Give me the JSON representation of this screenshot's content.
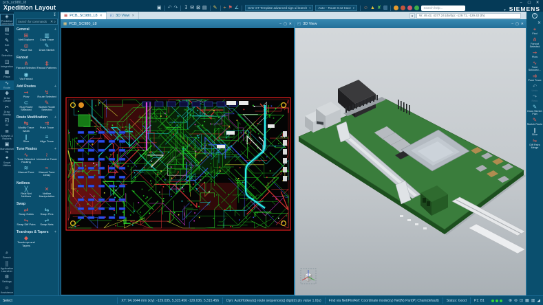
{
  "window": {
    "caption": "pcb_sc980_l8",
    "app_title": "Xpedition Layout",
    "brand": "SIEMENS",
    "controls": [
      {
        "name": "minimize-button",
        "glyph": "–"
      },
      {
        "name": "maximize-button",
        "glyph": "▢"
      },
      {
        "name": "close-button",
        "glyph": "✕"
      }
    ]
  },
  "toolbar": {
    "search_placeholder": "Search help...",
    "coordinate_readout": "W: 49.42, 4377.24 (dx/dy):  -129.71, -129.42 (th)",
    "items": [
      {
        "type": "icon",
        "name": "save-icon",
        "glyph": "▣",
        "color": "#cfe3ed"
      },
      {
        "type": "sep"
      },
      {
        "type": "icon",
        "name": "undo-icon",
        "glyph": "↶",
        "color": "#8fb6ca"
      },
      {
        "type": "icon",
        "name": "redo-icon",
        "glyph": "↷",
        "color": "#8fb6ca"
      },
      {
        "type": "sep"
      },
      {
        "type": "icon",
        "name": "pin-icon",
        "glyph": "↧",
        "color": "#cfe3ed"
      },
      {
        "type": "icon",
        "name": "mail-icon",
        "glyph": "✉",
        "color": "#cfe3ed"
      },
      {
        "type": "icon",
        "name": "lock-icon",
        "glyph": "⊠",
        "color": "#cfe3ed"
      },
      {
        "type": "icon",
        "name": "print-icon",
        "glyph": "▤",
        "color": "#cfe3ed"
      },
      {
        "type": "sep"
      },
      {
        "type": "icon",
        "name": "pencil-icon",
        "glyph": "✎",
        "color": "#e8c75a"
      },
      {
        "type": "sep"
      },
      {
        "type": "icon",
        "name": "probe-icon",
        "glyph": "⌖",
        "color": "#e0a060"
      },
      {
        "type": "icon",
        "name": "flag-icon",
        "glyph": "⚑",
        "color": "#d06060"
      },
      {
        "type": "icon",
        "name": "measure-icon",
        "glyph": "∠",
        "color": "#7fd1e8"
      },
      {
        "type": "sep"
      },
      {
        "type": "dropdown",
        "name": "scheme-dropdown",
        "label": "Over ST-Template advanced sign ui branch"
      },
      {
        "type": "dropdown",
        "name": "license-dropdown",
        "label": "Auto – Route 0:42 trace"
      },
      {
        "type": "sep"
      },
      {
        "type": "icon",
        "name": "person-icon",
        "glyph": "☺",
        "color": "#c08060"
      },
      {
        "type": "icon",
        "name": "warning-icon",
        "glyph": "▲",
        "color": "#e8c33a"
      },
      {
        "type": "icon",
        "name": "drc-icon",
        "glyph": "✘",
        "color": "#58b858"
      },
      {
        "type": "icon",
        "name": "clipboard-icon",
        "glyph": "▥",
        "color": "#7fb3d9"
      },
      {
        "type": "sep"
      },
      {
        "type": "circle",
        "name": "autosave-status-icon",
        "color": "#e59b2e"
      },
      {
        "type": "circle",
        "name": "sync-status-icon",
        "color": "#c2563e"
      },
      {
        "type": "circle",
        "name": "review-status-icon",
        "color": "#d4556a"
      },
      {
        "type": "circle",
        "name": "online-status-icon",
        "color": "#3fae49"
      },
      {
        "type": "search"
      }
    ]
  },
  "tabs": [
    {
      "label": "PCB_SC980_L8",
      "glyph": "▦",
      "glyph_color": "#c0504e",
      "active": true
    },
    {
      "label": "3D View",
      "glyph": "◰",
      "glyph_color": "#4e7ec0",
      "active": false
    }
  ],
  "left_strip": {
    "items": [
      {
        "label": "Predictive Commands",
        "name": "strip-predictive-commands",
        "glyph": "◈",
        "boxed": true
      },
      {
        "label": "File",
        "name": "strip-file",
        "glyph": "▤"
      },
      {
        "label": "Edit",
        "name": "strip-edit",
        "glyph": "✎"
      },
      {
        "label": "Selection",
        "name": "strip-selection",
        "glyph": "↖"
      },
      {
        "label": "Integration",
        "name": "strip-integration",
        "glyph": "◫"
      },
      {
        "label": "Place",
        "name": "strip-place",
        "glyph": "▦"
      },
      {
        "label": "Route",
        "name": "strip-route",
        "glyph": "∿",
        "selected": true
      },
      {
        "label": "Draw Create",
        "name": "strip-draw-create",
        "glyph": "✚"
      },
      {
        "label": "Draw Modify",
        "name": "strip-draw-modify",
        "glyph": "✂"
      },
      {
        "label": "3D",
        "name": "strip-3d",
        "glyph": "◰"
      },
      {
        "label": "Analysis & Reports",
        "name": "strip-analysis-reports",
        "glyph": "≣"
      },
      {
        "label": "Manufacturing",
        "name": "strip-manufacturing",
        "glyph": "▣"
      },
      {
        "label": "Smart Utilities",
        "name": "strip-smart-utilities",
        "glyph": "✦"
      }
    ],
    "bottom_items": [
      {
        "label": "Search",
        "name": "strip-search",
        "glyph": "⌕"
      },
      {
        "label": "Application Launcher",
        "name": "strip-app-launcher",
        "glyph": "⣿"
      },
      {
        "label": "Settings",
        "name": "strip-settings",
        "glyph": "⚙"
      },
      {
        "label": "Assistance",
        "name": "strip-assistance",
        "glyph": "☺"
      }
    ]
  },
  "command_panel": {
    "search_placeholder": "Search for commands",
    "sections": [
      {
        "title": "General",
        "plus": true,
        "items": [
          {
            "label": "Net Explorer",
            "glyph": "⊞",
            "color": "#e0635c"
          },
          {
            "label": "Copy Trace",
            "glyph": "▥",
            "color": "#7fd1e8"
          },
          {
            "label": "Place Via",
            "glyph": "◎",
            "color": "#e0635c"
          },
          {
            "label": "Draw Sketch",
            "glyph": "✎",
            "color": "#7fd1e8"
          }
        ]
      },
      {
        "title": "Fanout",
        "plus": false,
        "items": [
          {
            "label": "Fanout Selected",
            "glyph": "⋔",
            "color": "#e0635c"
          },
          {
            "label": "Fanout Patterns",
            "glyph": "⋕",
            "color": "#e0635c"
          },
          {
            "label": "Via Fanout",
            "glyph": "◉",
            "color": "#7fd1e8"
          }
        ]
      },
      {
        "title": "Add Routes",
        "plus": true,
        "items": [
          {
            "label": "Plow",
            "glyph": "⇝",
            "color": "#e0635c"
          },
          {
            "label": "Route Selected",
            "glyph": "↯",
            "color": "#e0635c"
          },
          {
            "label": "Hug Route Selected",
            "glyph": "⊂",
            "color": "#7fd1e8"
          },
          {
            "label": "Sketch Route Selected",
            "glyph": "✎",
            "color": "#e0635c"
          }
        ]
      },
      {
        "title": "Route Modification",
        "plus": true,
        "items": [
          {
            "label": "Modify Trace Width",
            "glyph": "↹",
            "color": "#e0635c"
          },
          {
            "label": "Push Trace",
            "glyph": "⇉",
            "color": "#e0635c"
          },
          {
            "label": "Slice",
            "glyph": "∥",
            "color": "#7fd1e8"
          },
          {
            "label": "Align Trace",
            "glyph": "≡",
            "color": "#7fd1e8"
          }
        ]
      },
      {
        "title": "Tune Routes",
        "plus": true,
        "items": [
          {
            "label": "Tune Selected Routing",
            "glyph": "∿",
            "color": "#e0635c"
          },
          {
            "label": "Interactive Tuner",
            "glyph": "≀",
            "color": "#e0635c"
          },
          {
            "label": "Manual Tune",
            "glyph": "≋",
            "color": "#7fd1e8"
          },
          {
            "label": "Manual Tune Delay",
            "glyph": "≈",
            "color": "#e0635c"
          }
        ]
      },
      {
        "title": "Netlines",
        "plus": false,
        "items": [
          {
            "label": "Real Net Netlines",
            "glyph": "╳",
            "color": "#7fd1e8"
          },
          {
            "label": "Netline Manipulation",
            "glyph": "✕",
            "color": "#e0635c"
          }
        ]
      },
      {
        "title": "Swap",
        "plus": false,
        "items": [
          {
            "label": "Swap Gates",
            "glyph": "⇄",
            "color": "#e0635c"
          },
          {
            "label": "Swap Pins",
            "glyph": "⇆",
            "color": "#7fd1e8"
          },
          {
            "label": "Swap Diff Pairs",
            "glyph": "⇋",
            "color": "#e0635c"
          },
          {
            "label": "Swap Nets",
            "glyph": "⇌",
            "color": "#7fd1e8"
          }
        ]
      },
      {
        "title": "Teardrops & Tapers",
        "plus": true,
        "items": [
          {
            "label": "Teardrops and Tapers",
            "glyph": "◆",
            "color": "#e0635c"
          }
        ]
      }
    ]
  },
  "pcb2d_panel": {
    "title": "PCB_SC980_L8",
    "window_buttons": [
      "–",
      "▢",
      "✕"
    ],
    "board_outline_color": "#ff2222",
    "trace_colors": [
      {
        "c": "#17a017",
        "w": 8
      },
      {
        "c": "#2ee82e",
        "w": 4
      },
      {
        "c": "#18c8c8",
        "w": 3
      },
      {
        "c": "#e03434",
        "w": 4
      },
      {
        "c": "#3b55e0",
        "w": 2
      },
      {
        "c": "#d43ad4",
        "w": 2
      },
      {
        "c": "#d8d838",
        "w": 1
      },
      {
        "c": "#e8e8e8",
        "w": 1
      }
    ]
  },
  "view3d_panel": {
    "title": "3D View",
    "window_buttons": [
      "–",
      "▢",
      "✕"
    ],
    "board_color": "#3a7d3c"
  },
  "right_strip": {
    "close_glyph": "✕",
    "items": [
      {
        "label": "Find",
        "name": "rs-find",
        "glyph": "⌖",
        "color": "#e0635c"
      },
      {
        "label": "Fanout Selected",
        "name": "rs-fanout-selected",
        "glyph": "⋔",
        "color": "#e0635c"
      },
      {
        "label": "Plow",
        "name": "rs-plow",
        "glyph": "⇝",
        "color": "#e0635c"
      },
      {
        "label": "Tune Selected…",
        "name": "rs-tune-selected",
        "glyph": "∿",
        "color": "#e0635c"
      },
      {
        "label": "Push Trace",
        "name": "rs-push-trace",
        "glyph": "⇉",
        "color": "#e0635c"
      },
      {
        "label": "Undo",
        "name": "rs-undo",
        "glyph": "↶",
        "color": "#8fb6ca",
        "disabled": true
      },
      {
        "label": "Redo",
        "name": "rs-redo",
        "glyph": "↷",
        "color": "#8fb6ca",
        "disabled": true
      },
      {
        "label": "Draw Sketch Plan",
        "name": "rs-draw-sketch-plan",
        "glyph": "✎",
        "color": "#7fd1e8"
      },
      {
        "label": "Sketch Route",
        "name": "rs-sketch-route",
        "glyph": "✎",
        "color": "#e0635c"
      },
      {
        "label": "Slice",
        "name": "rs-slice",
        "glyph": "∥",
        "color": "#cfe3ed"
      },
      {
        "label": "Diff Pairs Merge",
        "name": "rs-diff-pairs-merge",
        "glyph": "⇋",
        "color": "#e0635c"
      }
    ]
  },
  "status_bar": {
    "mode": "Select",
    "segments": [
      "XY: 94.1644 mm (x/y):  -129.035, 5,315.456   -129.036, 5,315.456",
      "Dyn: AutoHotkey(q) route sequence(q) digit(d) ply value 1.0(u)",
      "Find via Net/Pin/Ref: Coordinate mode(xy) Net(N) Part(P) Chain(default)",
      "Status: Good",
      "P1: B1"
    ],
    "led_count": 3,
    "led_color": "#39d239",
    "icons": [
      {
        "name": "zoom-in-icon",
        "glyph": "⊕"
      },
      {
        "name": "zoom-out-icon",
        "glyph": "⊖"
      },
      {
        "name": "zoom-fit-icon",
        "glyph": "⊡"
      },
      {
        "name": "window-tile-icon",
        "glyph": "▦"
      },
      {
        "name": "window-cascade-icon",
        "glyph": "▥"
      },
      {
        "name": "resize-grip",
        "glyph": "◢"
      }
    ]
  },
  "colors": {
    "accent": "#2a7ba0",
    "frame": "#053a57",
    "panel": "#0a4f6e",
    "strip": "#04304a",
    "canvas2d": "#000000",
    "status_green": "#39d239"
  }
}
